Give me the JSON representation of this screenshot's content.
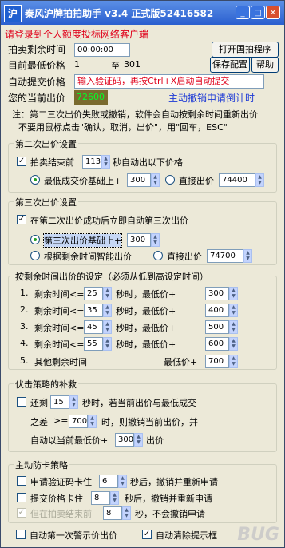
{
  "window": {
    "title": "秦风沪牌拍拍助手 v3.4 正式版52416582"
  },
  "header": {
    "notice": "请登录到个人额度投标网络客户端",
    "time_label": "拍卖剩余时间",
    "time_value": "00:00:00",
    "min_price_label": "目前最低价格",
    "min_price_from": "1",
    "min_price_to_label": "至",
    "min_price_to": "301",
    "auto_submit_label": "自动提交价格",
    "auto_submit_warning": "输入验证码，再按Ctrl+X启动自动提交",
    "bid_price_label": "您的当前出价",
    "bid_price_value": "72600",
    "cancel_countdown_label": "主动撤销申请倒计时",
    "open_site_button": "打开国拍程序",
    "save_config_button": "保存配置",
    "help_button": "帮助"
  },
  "note": {
    "line1": "注：第二三次出价失败或撤销，软件会自动按剩余时间重新出价",
    "line2": "不要用鼠标点击\"确认，取消，出价\"，用\"回车，ESC\""
  },
  "second_bid": {
    "title": "第二次出价设置",
    "check_label": "拍卖结束前",
    "seconds": "113",
    "check_suffix": "秒自动出以下价格",
    "option1_label": "最低成交价基础上+",
    "option1_value": "300",
    "option2_label": "直接出价",
    "option2_value": "74400"
  },
  "third_bid": {
    "title": "第三次出价设置",
    "check_label": "在第二次出价成功后立即自动第三次出价",
    "option1_label": "第三次出价基础上+",
    "option1_value": "300",
    "option2_label": "根据剩余时间智能出价",
    "option3_label": "直接出价",
    "option3_value": "74700"
  },
  "remaining_time": {
    "title": "按剩余时间出价的设定（必须从低到高设定时间）",
    "rows": [
      {
        "num": "1.",
        "label": "剩余时间<=",
        "seconds": "25",
        "mid": "秒时，最低价+",
        "add": "300"
      },
      {
        "num": "2.",
        "label": "剩余时间<=",
        "seconds": "35",
        "mid": "秒时，最低价+",
        "add": "400"
      },
      {
        "num": "3.",
        "label": "剩余时间<=",
        "seconds": "45",
        "mid": "秒时，最低价+",
        "add": "500"
      },
      {
        "num": "4.",
        "label": "剩余时间<=",
        "seconds": "55",
        "mid": "秒时，最低价+",
        "add": "600"
      }
    ],
    "row5_num": "5.",
    "row5_label": "其他剩余时间",
    "row5_mid": "最低价+",
    "row5_add": "700"
  },
  "fubi": {
    "title": "伏击策略的补救",
    "check_label": "还剩",
    "seconds": "15",
    "text1": "秒时，若当前出价与最低成交",
    "text2": "之差",
    "op": ">=",
    "diff": "700",
    "text3": "时，则撤销当前出价，并",
    "text4": "自动以当前最低价+",
    "add": "300",
    "text5": "出价"
  },
  "anti_card": {
    "title": "主动防卡策略",
    "row1_label": "申请验证码卡住",
    "row1_value": "6",
    "row1_suffix": "秒后，撤销并重新申请",
    "row2_label": "提交价格卡住",
    "row2_value": "8",
    "row2_suffix": "秒后，撤销并重新申请",
    "row3_label": "但在拍卖结束前",
    "row3_value": "8",
    "row3_suffix": "秒，不会撤销申请"
  },
  "footer": {
    "check1_label": "自动第一次警示价出价",
    "check2_label": "自动清除提示框"
  },
  "watermark": "BUG"
}
